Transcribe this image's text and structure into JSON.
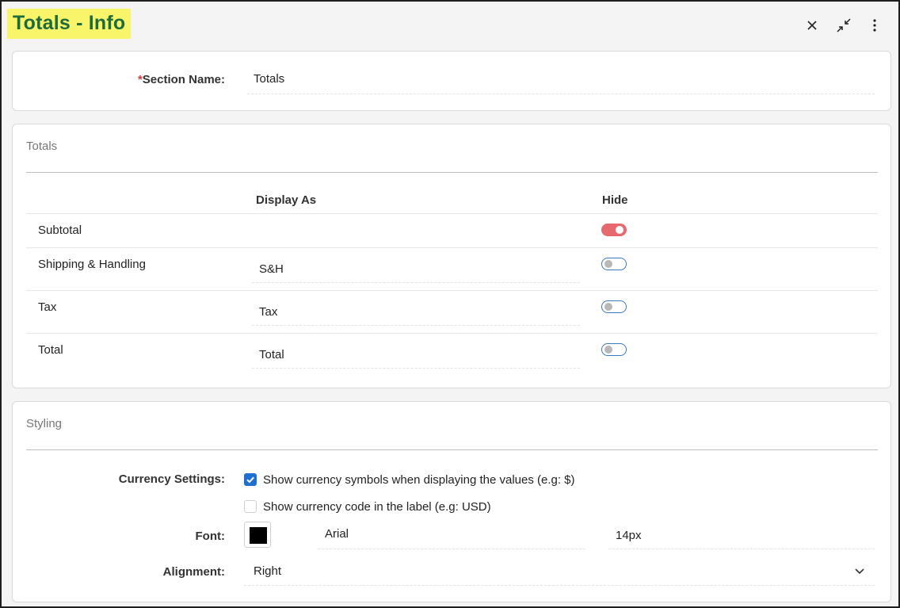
{
  "header": {
    "title": "Totals - Info"
  },
  "controls": {
    "close_icon": "close-icon",
    "collapse_icon": "collapse-icon",
    "menu_icon": "kebab-menu-icon"
  },
  "section": {
    "required_mark": "*",
    "label": "Section Name:",
    "value": "Totals"
  },
  "totals": {
    "title": "Totals",
    "col_display": "Display As",
    "col_hide": "Hide",
    "rows": [
      {
        "label": "Subtotal",
        "display_as": "",
        "hide": true
      },
      {
        "label": "Shipping & Handling",
        "display_as": "S&H",
        "hide": false
      },
      {
        "label": "Tax",
        "display_as": "Tax",
        "hide": false
      },
      {
        "label": "Total",
        "display_as": "Total",
        "hide": false
      }
    ]
  },
  "styling": {
    "title": "Styling",
    "currency_label": "Currency Settings:",
    "currency_symbols": {
      "label": "Show currency symbols when displaying the values (e.g: $)",
      "checked": true
    },
    "currency_code": {
      "label": "Show currency code in the label (e.g: USD)",
      "checked": false
    },
    "font_label": "Font:",
    "font_color": "#000000",
    "font_family": "Arial",
    "font_size": "14px",
    "alignment_label": "Alignment:",
    "alignment_value": "Right"
  },
  "colors": {
    "title_bg": "#f8f56a",
    "title_text": "#1e6b3c",
    "toggle_on": "#e6696e",
    "toggle_off_border": "#3b78c4",
    "checkbox_on": "#1f6fd1"
  }
}
